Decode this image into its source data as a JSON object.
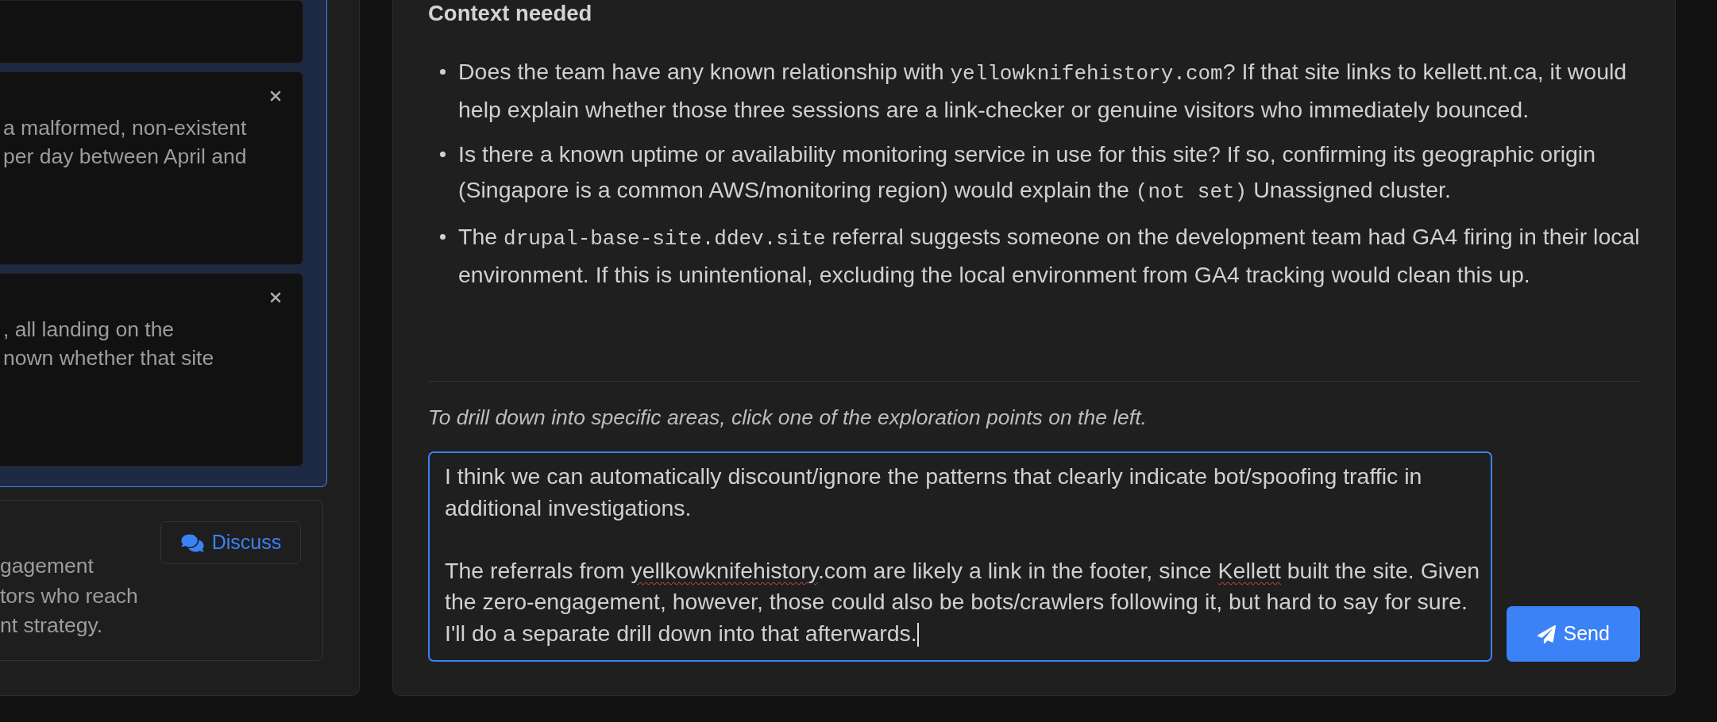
{
  "left_panel": {
    "group": {
      "selected": true,
      "cards": [
        {
          "close_button": false
        },
        {
          "close_button": true,
          "text": "a malformed, non-existent\nper day between April and"
        },
        {
          "close_button": true,
          "text": ", all landing on the\nnown whether that site"
        }
      ]
    },
    "card": {
      "text": "gagement\ntors who reach\nnt strategy.",
      "button": {
        "label": "Discuss"
      }
    }
  },
  "main_panel": {
    "heading": "Context needed",
    "bullets": [
      {
        "segments": [
          {
            "kind": "text",
            "text": "Does the team have any known relationship with "
          },
          {
            "kind": "code",
            "text": "yellowknifehistory.com"
          },
          {
            "kind": "text",
            "text": "? If that site links to kellett.nt.ca, it would help explain whether those three sessions are a link-checker or genuine visitors who immediately bounced."
          }
        ]
      },
      {
        "segments": [
          {
            "kind": "text",
            "text": "Is there a known uptime or availability monitoring service in use for this site? If so, confirming its geographic origin (Singapore is a common AWS/monitoring region) would explain the "
          },
          {
            "kind": "code",
            "text": "(not set)"
          },
          {
            "kind": "text",
            "text": " Unassigned cluster."
          }
        ]
      },
      {
        "segments": [
          {
            "kind": "text",
            "text": "The "
          },
          {
            "kind": "code",
            "text": "drupal-base-site.ddev.site"
          },
          {
            "kind": "text",
            "text": " referral suggests someone on the development team had GA4 firing in their local environment. If this is unintentional, excluding the local environment from GA4 tracking would clean this up."
          }
        ]
      }
    ],
    "hint": "To drill down into specific areas, click one of the exploration points on the left.",
    "message_field": {
      "focused": true,
      "value": [
        {
          "text": "I think we can automatically discount/ignore the patterns that clearly indicate bot/spoofing traffic in additional investigations.\n\nThe referrals from ",
          "misspelled": false
        },
        {
          "text": "yellkowknifehistory",
          "misspelled": true
        },
        {
          "text": ".com are likely a link in the footer, since ",
          "misspelled": false
        },
        {
          "text": "Kellett",
          "misspelled": true
        },
        {
          "text": " built the site. Given the zero-engagement, however, those could also be bots/crawlers following it, but hard to say for sure. I'll do a separate drill down into that afterwards.",
          "misspelled": false
        }
      ]
    },
    "send_button": {
      "label": "Send"
    }
  }
}
